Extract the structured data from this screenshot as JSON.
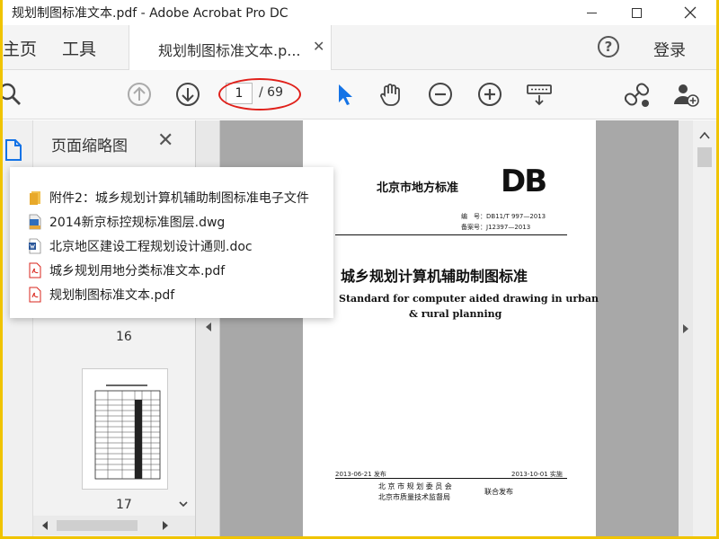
{
  "window": {
    "title": "规划制图标准文本.pdf - Adobe Acrobat Pro DC"
  },
  "tabs": {
    "home": "主页",
    "tools": "工具",
    "doc_tab": "规划制图标准文本.p...",
    "login": "登录"
  },
  "toolbar": {
    "current_page": "1",
    "total_pages": "/ 69"
  },
  "thumbnails": {
    "title": "页面缩略图",
    "page16": "16",
    "page17": "17"
  },
  "recent_files": [
    {
      "name": "附件2：城乡规划计算机辅助制图标准电子文件",
      "icon": "folder-icon"
    },
    {
      "name": "2014新京标控规标准图层.dwg",
      "icon": "dwg-file-icon"
    },
    {
      "name": "北京地区建设工程规划设计通则.doc",
      "icon": "word-file-icon"
    },
    {
      "name": "城乡规划用地分类标准文本.pdf",
      "icon": "pdf-file-icon"
    },
    {
      "name": "规划制图标准文本.pdf",
      "icon": "pdf-file-icon"
    }
  ],
  "pdf_page": {
    "org": "北京市地方标准",
    "db_logo": "DB",
    "code_line": "编　号：DB11/T 997—2013",
    "record_line": "备案号：J12397—2013",
    "title_cn": "城乡规划计算机辅助制图标准",
    "title_en_1": "Standard for computer aided drawing in urban",
    "title_en_2": "& rural planning",
    "issue_date": "2013-06-21 发布",
    "impl_date": "2013-10-01 实施",
    "publisher_1": "北 京 市 规 划 委 员 会",
    "publisher_2": "北京市质量技术监督局",
    "joint": "联合发布"
  },
  "colors": {
    "accent": "#1473e6",
    "annotation": "#e0201a",
    "pdf_red": "#d9251c"
  }
}
